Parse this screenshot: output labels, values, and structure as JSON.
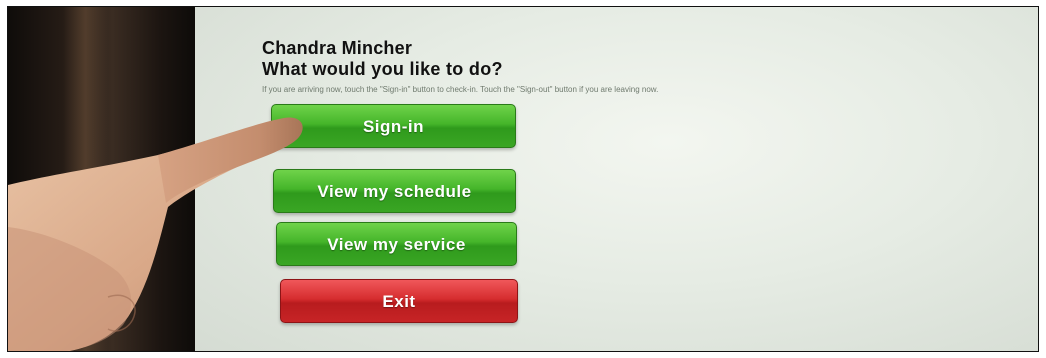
{
  "kiosk": {
    "user_name": "Chandra Mincher",
    "prompt": "What would you like to do?",
    "instructions": "If you are arriving now, touch the \"Sign-in\" button to check-in. Touch the \"Sign-out\" button if you are leaving now."
  },
  "buttons": {
    "signin_label": "Sign-in",
    "schedule_label": "View my schedule",
    "service_label": "View my service",
    "exit_label": "Exit"
  },
  "colors": {
    "button_green": "#45b52a",
    "button_red": "#d62d2f",
    "screen_background": "#e6ece4"
  }
}
